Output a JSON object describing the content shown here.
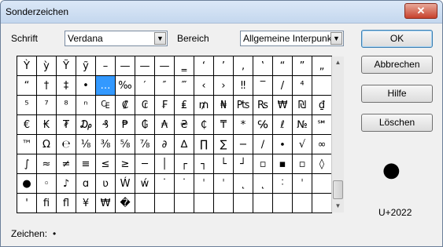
{
  "window": {
    "title": "Sonderzeichen",
    "close_label": "✕"
  },
  "font": {
    "label": "Schrift",
    "selected": "Verdana"
  },
  "range": {
    "label": "Bereich",
    "selected": "Allgemeine Interpunk"
  },
  "buttons": {
    "ok": "OK",
    "cancel": "Abbrechen",
    "help": "Hilfe",
    "delete": "Löschen"
  },
  "grid": {
    "selected_index": 20,
    "chars": [
      "Ỳ",
      "ỳ",
      "Ỹ",
      "ỹ",
      "–",
      "—",
      "—",
      "—",
      "‗",
      "‘",
      "’",
      "‚",
      "‛",
      "“",
      "”",
      "„",
      "“",
      "†",
      "‡",
      "•",
      "…",
      "‰",
      "′",
      "″",
      "‴",
      "‹",
      "›",
      "‼",
      "‾",
      "/",
      "⁴",
      "",
      "⁵",
      "⁷",
      "⁸",
      "ⁿ",
      "₠",
      "₡",
      "₢",
      "₣",
      "₤",
      "₥",
      "₦",
      "₧",
      "₨",
      "₩",
      "₪",
      "₫",
      "€",
      "₭",
      "₮",
      "₯",
      "₰",
      "₱",
      "₲",
      "₳",
      "₴",
      "₵",
      "₸",
      "*",
      "℅",
      "ℓ",
      "№",
      "℠",
      "™",
      "Ω",
      "℮",
      "⅛",
      "⅜",
      "⅝",
      "⅞",
      "∂",
      "∆",
      "∏",
      "∑",
      "−",
      "∕",
      "∙",
      "√",
      "∞",
      "∫",
      "≈",
      "≠",
      "≡",
      "≤",
      "≥",
      "─",
      "│",
      "┌",
      "┐",
      "└",
      "┘",
      "▫",
      "▪",
      "▫",
      "◊",
      "●",
      "◦",
      "♪",
      "ɑ",
      "ʋ",
      "Ẃ",
      "ẃ",
      "˙",
      "˙",
      "ˈ",
      "ˈ",
      "˛",
      "˛",
      "˸",
      "ˈ",
      "",
      "'",
      "ﬁ",
      "ﬂ",
      "¥",
      "₩",
      "�",
      "",
      "",
      "",
      "",
      "",
      "",
      "",
      "",
      "",
      ""
    ]
  },
  "preview": {
    "char": "●",
    "code": "U+2022"
  },
  "status": {
    "label": "Zeichen:",
    "chars": "•"
  }
}
